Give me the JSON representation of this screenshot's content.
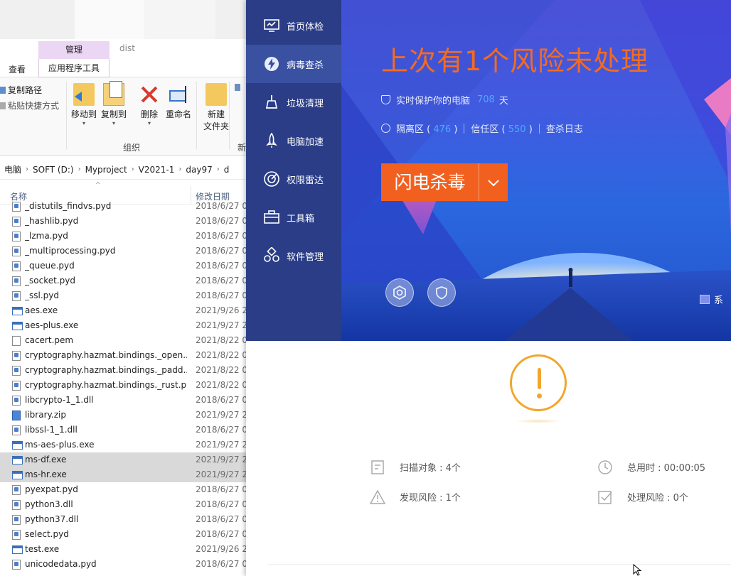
{
  "explorer": {
    "ribbon_tabs": {
      "manage": "管理",
      "window_title": "dist",
      "view": "查看",
      "app_tools": "应用程序工具"
    },
    "ribbon": {
      "copy_path": "复制路径",
      "paste_shortcut": "粘贴快捷方式",
      "move_to": "移动到",
      "copy_to": "复制到",
      "delete": "删除",
      "rename": "重命名",
      "new_folder_line1": "新建",
      "new_folder_line2": "文件夹",
      "group_organize": "组织",
      "group_new_partial": "新"
    },
    "breadcrumb": [
      "电脑",
      "SOFT (D:)",
      "Myproject",
      "V2021-1",
      "day97",
      "d"
    ],
    "columns": {
      "name": "名称",
      "date": "修改日期"
    },
    "files": [
      {
        "name": "_distutils_findvs.pyd",
        "date": "2018/6/27 0",
        "type": "pyd"
      },
      {
        "name": "_hashlib.pyd",
        "date": "2018/6/27 0",
        "type": "pyd"
      },
      {
        "name": "_lzma.pyd",
        "date": "2018/6/27 0",
        "type": "pyd"
      },
      {
        "name": "_multiprocessing.pyd",
        "date": "2018/6/27 0",
        "type": "pyd"
      },
      {
        "name": "_queue.pyd",
        "date": "2018/6/27 0",
        "type": "pyd"
      },
      {
        "name": "_socket.pyd",
        "date": "2018/6/27 0",
        "type": "pyd"
      },
      {
        "name": "_ssl.pyd",
        "date": "2018/6/27 0",
        "type": "pyd"
      },
      {
        "name": "aes.exe",
        "date": "2021/9/26 2",
        "type": "exe"
      },
      {
        "name": "aes-plus.exe",
        "date": "2021/9/27 2",
        "type": "exe"
      },
      {
        "name": "cacert.pem",
        "date": "2021/8/22 0",
        "type": "file"
      },
      {
        "name": "cryptography.hazmat.bindings._open...",
        "date": "2021/8/22 0",
        "type": "pyd"
      },
      {
        "name": "cryptography.hazmat.bindings._padd...",
        "date": "2021/8/22 0",
        "type": "pyd"
      },
      {
        "name": "cryptography.hazmat.bindings._rust.p...",
        "date": "2021/8/22 0",
        "type": "pyd"
      },
      {
        "name": "libcrypto-1_1.dll",
        "date": "2018/6/27 0",
        "type": "pyd"
      },
      {
        "name": "library.zip",
        "date": "2021/9/27 2",
        "type": "zip"
      },
      {
        "name": "libssl-1_1.dll",
        "date": "2018/6/27 0",
        "type": "pyd"
      },
      {
        "name": "ms-aes-plus.exe",
        "date": "2021/9/27 2",
        "type": "exe"
      },
      {
        "name": "ms-df.exe",
        "date": "2021/9/27 2",
        "type": "exe",
        "selected": true
      },
      {
        "name": "ms-hr.exe",
        "date": "2021/9/27 2",
        "type": "exe",
        "selected": true
      },
      {
        "name": "pyexpat.pyd",
        "date": "2018/6/27 0",
        "type": "pyd"
      },
      {
        "name": "python3.dll",
        "date": "2018/6/27 0",
        "type": "pyd"
      },
      {
        "name": "python37.dll",
        "date": "2018/6/27 0",
        "type": "pyd"
      },
      {
        "name": "select.pyd",
        "date": "2018/6/27 0",
        "type": "pyd"
      },
      {
        "name": "test.exe",
        "date": "2021/9/26 2",
        "type": "exe"
      },
      {
        "name": "unicodedata.pyd",
        "date": "2018/6/27 0",
        "type": "pyd"
      }
    ]
  },
  "antivirus": {
    "nav": [
      {
        "label": "首页体检",
        "icon": "monitor-check-icon"
      },
      {
        "label": "病毒查杀",
        "icon": "lightning-shield-icon",
        "active": true
      },
      {
        "label": "垃圾清理",
        "icon": "broom-icon"
      },
      {
        "label": "电脑加速",
        "icon": "rocket-icon"
      },
      {
        "label": "权限雷达",
        "icon": "radar-icon"
      },
      {
        "label": "工具箱",
        "icon": "toolbox-icon"
      },
      {
        "label": "软件管理",
        "icon": "apps-icon"
      }
    ],
    "alert_title": "上次有1个风险未处理",
    "protect": {
      "prefix": "实时保护你的电脑",
      "days": "708",
      "suffix": "天"
    },
    "quarantine": {
      "label": "隔离区 (",
      "count": "476",
      "close": ")"
    },
    "trust": {
      "label": "信任区 (",
      "count": "550",
      "close": ")"
    },
    "log": "查杀日志",
    "scan_button": "闪电杀毒",
    "system_label": "系",
    "stats": {
      "scanned": "扫描对象 : 4个",
      "total_time": "总用时 : 00:00:05",
      "risks_found": "发现风险 : 1个",
      "risks_handled": "处理风险 : 0个"
    },
    "colors": {
      "accent": "#f2601f",
      "highlight": "#52a7ff",
      "warning": "#f2a62b",
      "sidebar": "#2a3d86"
    }
  }
}
